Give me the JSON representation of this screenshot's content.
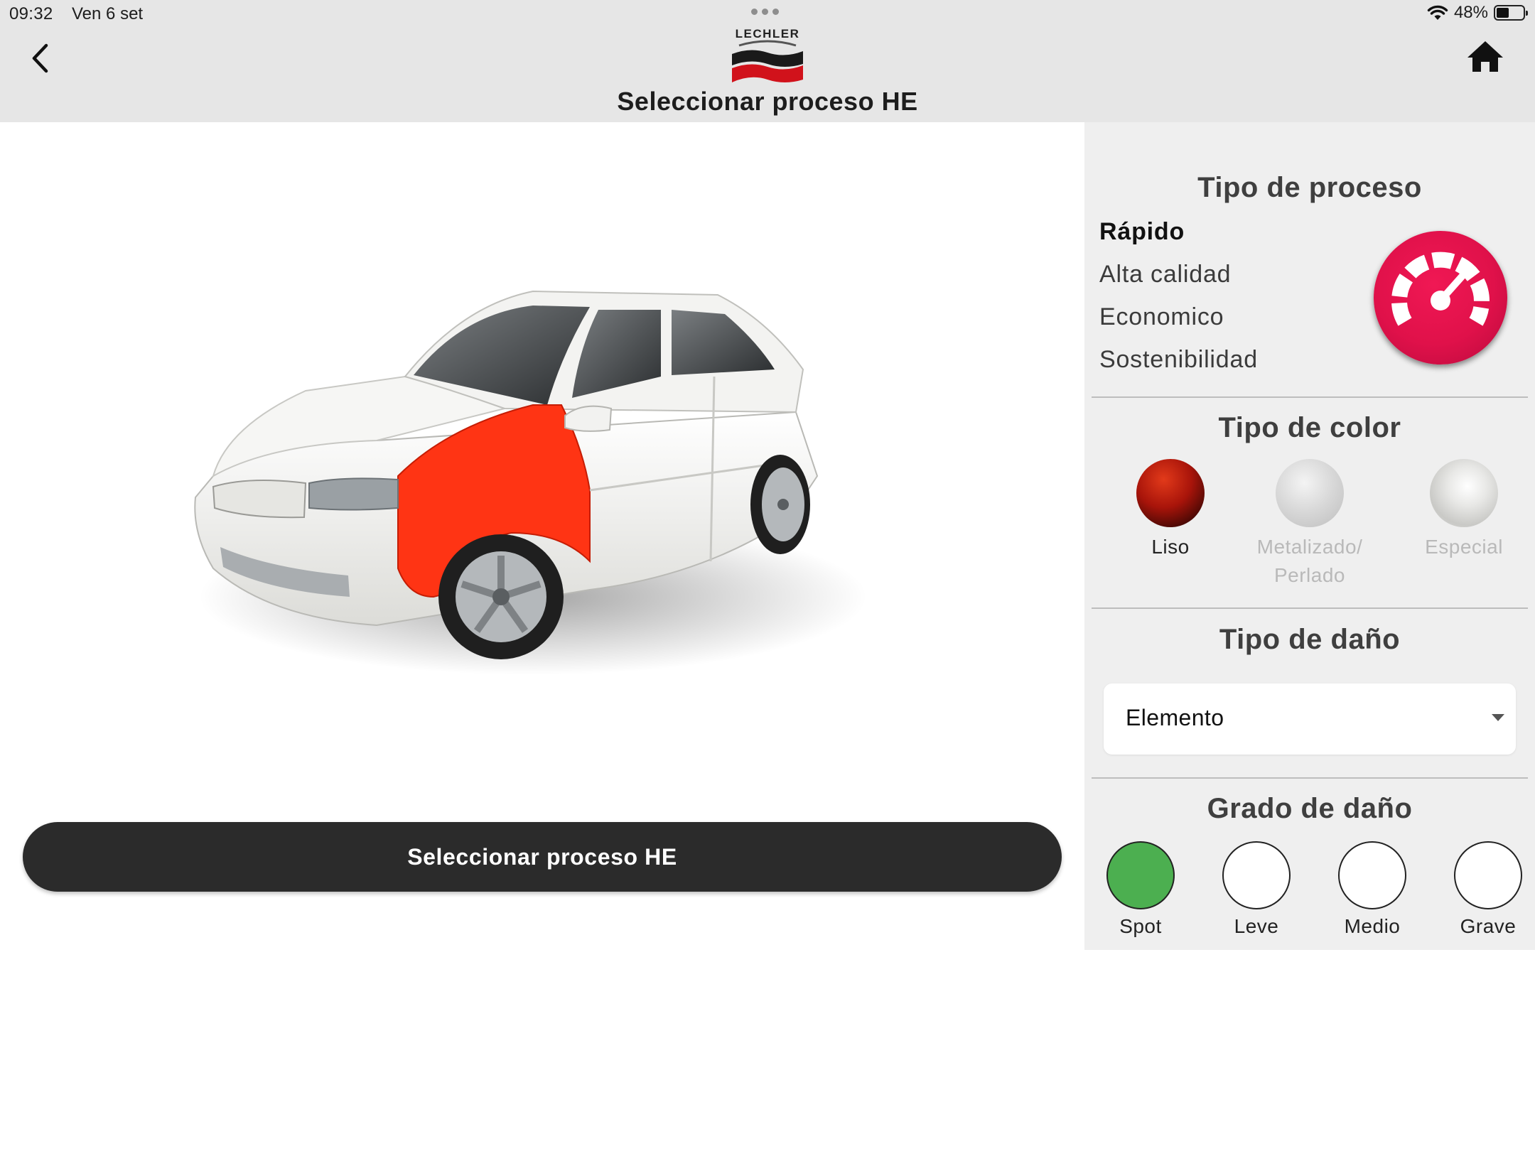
{
  "status_bar": {
    "time": "09:32",
    "date": "Ven 6 set",
    "battery": "48%",
    "battery_level": 0.48
  },
  "header": {
    "brand": "LECHLER",
    "title": "Seleccionar proceso HE"
  },
  "main": {
    "button_label": "Seleccionar proceso HE"
  },
  "panel": {
    "process": {
      "title": "Tipo de proceso",
      "options": [
        "Rápido",
        "Alta calidad",
        "Economico",
        "Sostenibilidad"
      ],
      "selected": "Rápido",
      "icon": "speedometer-icon"
    },
    "color": {
      "title": "Tipo de color",
      "options": [
        {
          "label": "Liso",
          "enabled": true
        },
        {
          "label": "Metalizado/",
          "label2": "Perlado",
          "enabled": false
        },
        {
          "label": "Especial",
          "enabled": false
        }
      ]
    },
    "damage_type": {
      "title": "Tipo de daño",
      "value": "Elemento"
    },
    "damage_grade": {
      "title": "Grado de daño",
      "options": [
        "Spot",
        "Leve",
        "Medio",
        "Grave"
      ],
      "selected": "Spot"
    }
  },
  "colors": {
    "header_bg": "#e6e6e6",
    "panel_bg": "#efefef",
    "button_bg": "#2b2b2b",
    "accent": "#e0114a",
    "active_grade": "#4caf50",
    "highlight_part": "#ff3414"
  }
}
